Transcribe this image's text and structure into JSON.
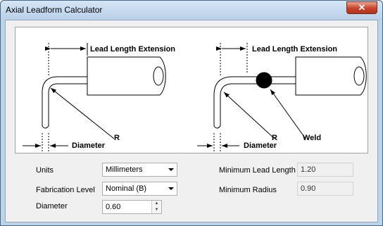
{
  "window": {
    "title": "Axial Leadform Calculator",
    "close_glyph": "✕"
  },
  "diagram": {
    "left": {
      "lead_length_extension": "Lead Length Extension",
      "r": "R",
      "diameter": "Diameter"
    },
    "right": {
      "lead_length_extension": "Lead Length Extension",
      "r": "R",
      "weld": "Weld",
      "diameter": "Diameter"
    }
  },
  "form": {
    "units_label": "Units",
    "units_value": "Millimeters",
    "fabrication_label": "Fabrication Level",
    "fabrication_value": "Nominal (B)",
    "diameter_label": "Diameter",
    "diameter_value": "0.60",
    "min_lead_length_label": "Minimum Lead Length",
    "min_lead_length_value": "1.20",
    "min_radius_label": "Minimum Radius",
    "min_radius_value": "0.90"
  }
}
